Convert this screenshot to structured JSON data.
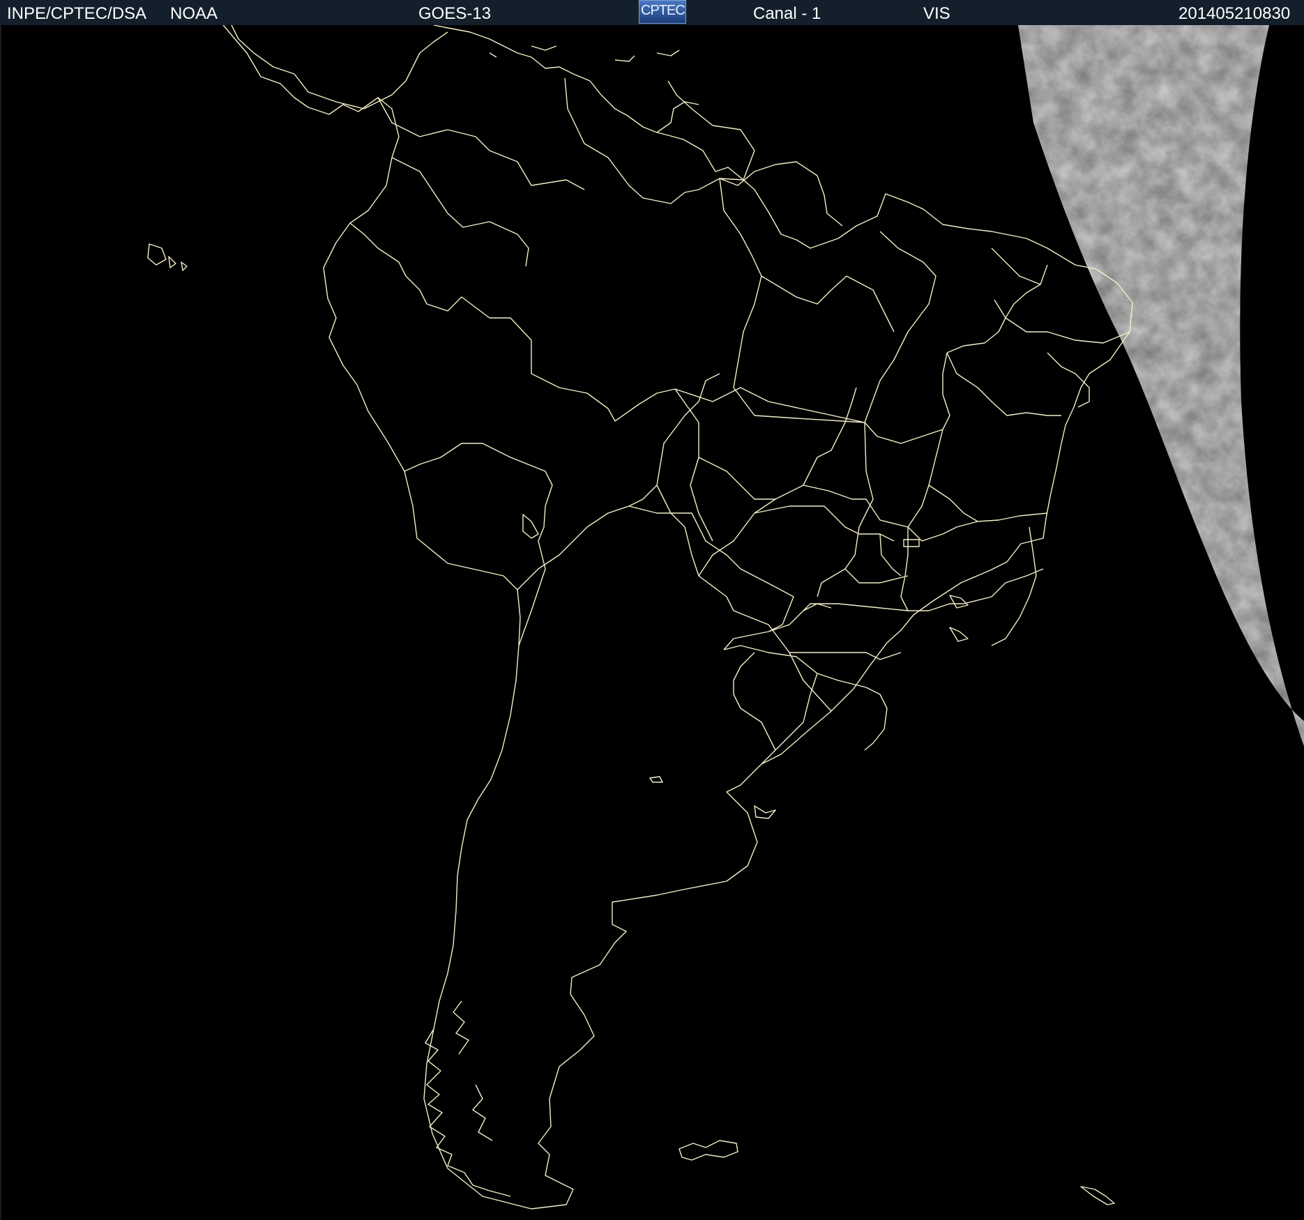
{
  "header": {
    "institution": "INPE/CPTEC/DSA",
    "agency": "NOAA",
    "satellite": "GOES-13",
    "logo_text": "CPTEC",
    "channel": "Canal - 1",
    "band": "VIS",
    "timestamp": "201405210830"
  },
  "colors": {
    "background": "#000000",
    "header_bg": "#13202c",
    "header_text": "#ffffff",
    "boundary_lines": "#f4f0c8",
    "cloud_band": "#9a9a9a"
  },
  "map": {
    "region": "South America",
    "layers": [
      "coastlines",
      "national-borders",
      "state-borders",
      "visible-channel-imagery"
    ]
  }
}
